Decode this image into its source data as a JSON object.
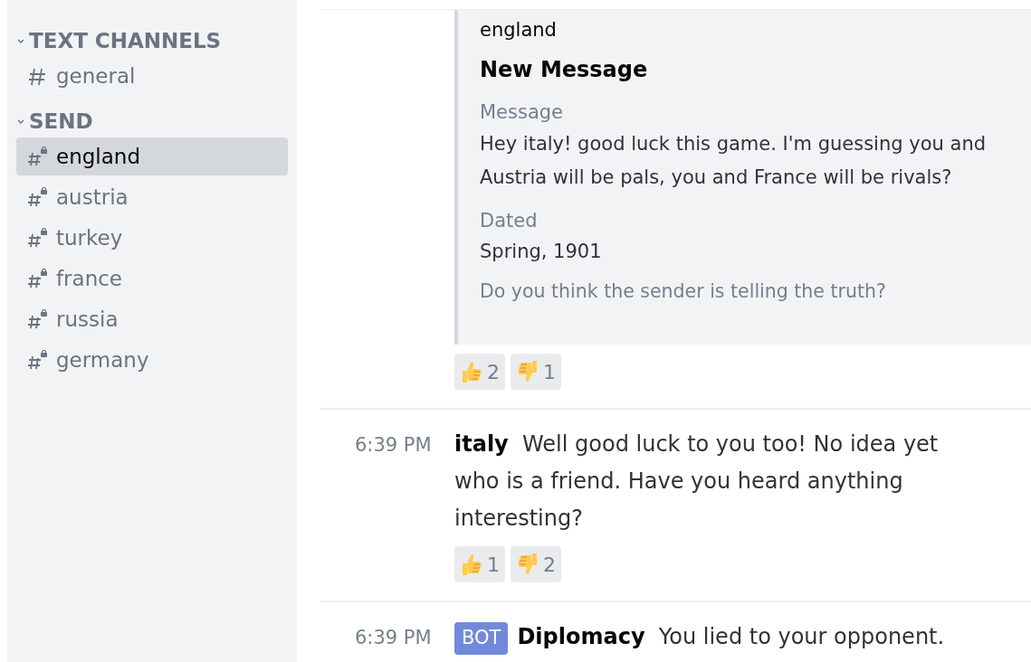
{
  "sidebar": {
    "categories": [
      {
        "name": "TEXT CHANNELS",
        "expanded": true,
        "channels": [
          {
            "name": "general",
            "locked": false,
            "selected": false
          }
        ]
      },
      {
        "name": "SEND",
        "expanded": true,
        "channels": [
          {
            "name": "england",
            "locked": true,
            "selected": true
          },
          {
            "name": "austria",
            "locked": true,
            "selected": false
          },
          {
            "name": "turkey",
            "locked": true,
            "selected": false
          },
          {
            "name": "france",
            "locked": true,
            "selected": false
          },
          {
            "name": "russia",
            "locked": true,
            "selected": false
          },
          {
            "name": "germany",
            "locked": true,
            "selected": false
          }
        ]
      }
    ]
  },
  "messages": [
    {
      "embed": {
        "author": "england",
        "title": "New Message",
        "fields": [
          {
            "name": "Message",
            "value": "Hey italy! good luck this game. I'm guessing you and Austria will be pals, you and France will be rivals?"
          },
          {
            "name": "Dated",
            "value": "Spring, 1901"
          }
        ],
        "footer": "Do you think the sender is telling the truth?"
      },
      "reactions": [
        {
          "kind": "thumbs-up",
          "count": "2"
        },
        {
          "kind": "thumbs-down",
          "count": "1"
        }
      ]
    },
    {
      "time": "6:39 PM",
      "author": "italy",
      "text": "Well good luck to you too! No idea yet who is a friend. Have you heard anything interesting?",
      "reactions": [
        {
          "kind": "thumbs-up",
          "count": "1"
        },
        {
          "kind": "thumbs-down",
          "count": "2"
        }
      ]
    },
    {
      "time": "6:39 PM",
      "bot": true,
      "tag": "BOT",
      "author": "Diplomacy",
      "text": "You lied to your opponent."
    }
  ]
}
